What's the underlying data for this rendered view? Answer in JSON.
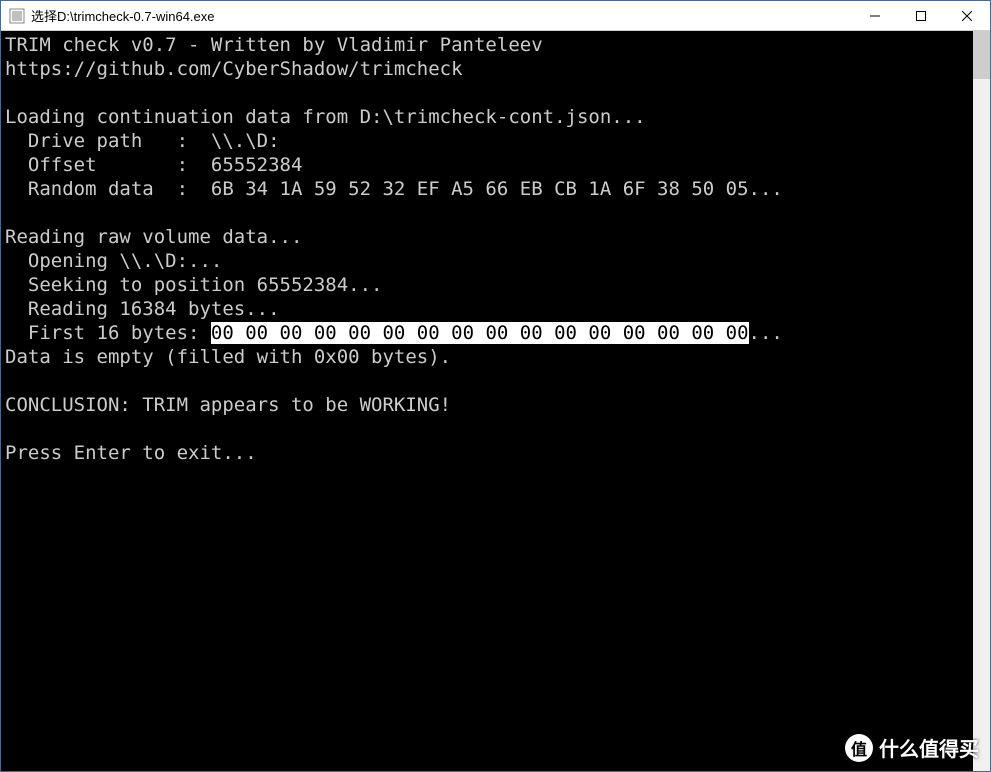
{
  "window": {
    "title": "选择D:\\trimcheck-0.7-win64.exe"
  },
  "console": {
    "line1": "TRIM check v0.7 - Written by Vladimir Panteleev",
    "line2": "https://github.com/CyberShadow/trimcheck",
    "line3": "",
    "line4": "Loading continuation data from D:\\trimcheck-cont.json...",
    "line5": "  Drive path   :  \\\\.\\D:",
    "line6": "  Offset       :  65552384",
    "line7": "  Random data  :  6B 34 1A 59 52 32 EF A5 66 EB CB 1A 6F 38 50 05...",
    "line8": "",
    "line9": "Reading raw volume data...",
    "line10": "  Opening \\\\.\\D:...",
    "line11": "  Seeking to position 65552384...",
    "line12": "  Reading 16384 bytes...",
    "line13a": "  First 16 bytes: ",
    "line13b": "00 00 00 00 00 00 00 00 00 00 00 00 00 00 00 00",
    "line13c": "...",
    "line14": "Data is empty (filled with 0x00 bytes).",
    "line15": "",
    "line16": "CONCLUSION: TRIM appears to be WORKING!",
    "line17": "",
    "line18": "Press Enter to exit..."
  },
  "watermark": {
    "badge": "值",
    "text": "什么值得买"
  }
}
